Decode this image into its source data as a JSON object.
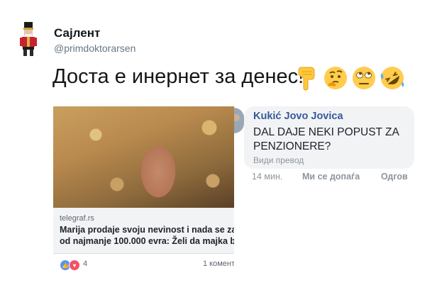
{
  "tweet": {
    "author_name": "Сајлент",
    "author_handle": "@primdoktorarsen",
    "text": "Доста е инернет за денес!",
    "emojis": [
      "point-down-icon",
      "thinking-face-icon",
      "eye-roll-face-icon",
      "rolling-laughing-face-icon"
    ]
  },
  "shared_post": {
    "domain": "telegraf.rs",
    "headline_line1": "Marija prodaje svoju nevinost i nada se za",
    "headline_line2": "od najmanje 100.000 evra: Želi da majka b",
    "reaction_icons": [
      "like-icon",
      "love-icon"
    ],
    "reaction_count": "4",
    "comment_count": "1 комент"
  },
  "comment": {
    "author": "Kukić Jovo Jovica",
    "text": "DAL DAJE NEKI POPUST ZA PENZIONERE?",
    "translate_label": "Види превод",
    "time": "14 мин.",
    "like_label": "Ми се допаѓа",
    "reply_label": "Одгов"
  },
  "colors": {
    "link_blue": "#365899",
    "bubble_bg": "#f2f3f5",
    "like_blue": "#5890ff",
    "love_red": "#f25268"
  }
}
